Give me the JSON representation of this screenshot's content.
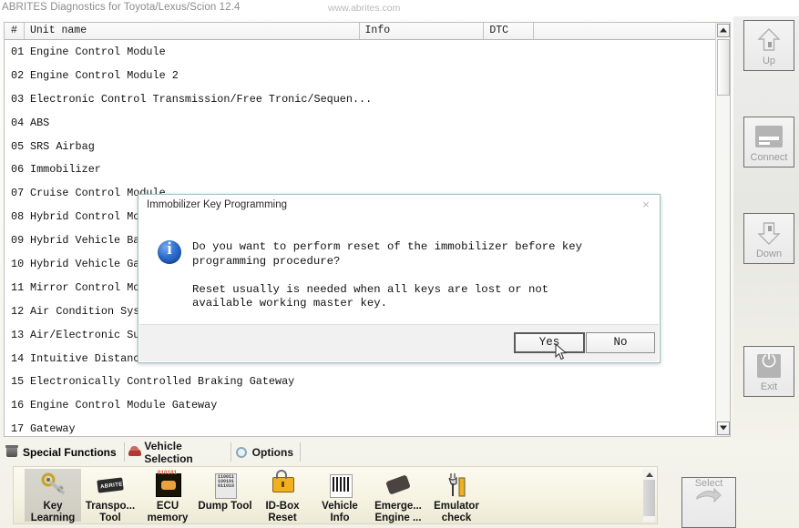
{
  "window": {
    "app_title": "ABRITES Diagnostics for Toyota/Lexus/Scion 12.4",
    "website": "www.abrites.com"
  },
  "table": {
    "columns": [
      "#",
      "Unit name",
      "Info",
      "DTC",
      ""
    ],
    "rows": [
      {
        "idx": "01",
        "name": "Engine Control Module",
        "info": "",
        "dtc": ""
      },
      {
        "idx": "02",
        "name": "Engine Control Module 2",
        "info": "",
        "dtc": ""
      },
      {
        "idx": "03",
        "name": "Electronic Control Transmission/Free Tronic/Sequen...",
        "info": "",
        "dtc": ""
      },
      {
        "idx": "04",
        "name": "ABS",
        "info": "",
        "dtc": ""
      },
      {
        "idx": "05",
        "name": "SRS Airbag",
        "info": "",
        "dtc": ""
      },
      {
        "idx": "06",
        "name": "Immobilizer",
        "info": "",
        "dtc": ""
      },
      {
        "idx": "07",
        "name": "Cruise Control Module",
        "info": "",
        "dtc": ""
      },
      {
        "idx": "08",
        "name": "Hybrid Control Module",
        "info": "",
        "dtc": ""
      },
      {
        "idx": "09",
        "name": "Hybrid Vehicle Battery",
        "info": "",
        "dtc": ""
      },
      {
        "idx": "10",
        "name": "Hybrid Vehicle Gateway",
        "info": "",
        "dtc": ""
      },
      {
        "idx": "11",
        "name": "Mirror Control Module",
        "info": "",
        "dtc": ""
      },
      {
        "idx": "12",
        "name": "Air Condition System",
        "info": "",
        "dtc": ""
      },
      {
        "idx": "13",
        "name": "Air/Electronic Suspension",
        "info": "",
        "dtc": ""
      },
      {
        "idx": "14",
        "name": "Intuitive Distance Assistance/Clearance Sonar",
        "info": "",
        "dtc": ""
      },
      {
        "idx": "15",
        "name": "Electronically Controlled Braking Gateway",
        "info": "",
        "dtc": ""
      },
      {
        "idx": "16",
        "name": "Engine Control Module Gateway",
        "info": "",
        "dtc": ""
      },
      {
        "idx": "17",
        "name": "Gateway",
        "info": "",
        "dtc": ""
      }
    ]
  },
  "sidebar": {
    "buttons": [
      {
        "id": "up",
        "label": "Up",
        "icon": "arrow-up-icon",
        "enabled": false
      },
      {
        "id": "connect",
        "label": "Connect",
        "icon": "connector-icon",
        "enabled": false
      },
      {
        "id": "down",
        "label": "Down",
        "icon": "arrow-down-icon",
        "enabled": false
      },
      {
        "id": "exit",
        "label": "Exit",
        "icon": "power-icon",
        "enabled": false
      }
    ]
  },
  "tabs": [
    {
      "label": "Special Functions",
      "icon": "toolbox-icon",
      "active": true
    },
    {
      "label": "Vehicle Selection",
      "icon": "car-icon",
      "active": false
    },
    {
      "label": "Options",
      "icon": "gear-icon",
      "active": false
    }
  ],
  "functions": [
    {
      "line1": "Key",
      "line2": "Learning",
      "icon": "key-icon",
      "selected": true
    },
    {
      "line1": "Transpo...",
      "line2": "Tool",
      "icon": "transponder-icon",
      "selected": false
    },
    {
      "line1": "ECU",
      "line2": "memory",
      "icon": "ecu-memory-icon",
      "selected": false
    },
    {
      "line1": "Dump Tool",
      "line2": "",
      "icon": "dump-tool-icon",
      "selected": false
    },
    {
      "line1": "ID-Box",
      "line2": "Reset",
      "icon": "padlock-icon",
      "selected": false
    },
    {
      "line1": "Vehicle",
      "line2": "Info",
      "icon": "barcode-icon",
      "selected": false
    },
    {
      "line1": "Emerge...",
      "line2": "Engine ...",
      "icon": "chip-icon",
      "selected": false
    },
    {
      "line1": "Emulator",
      "line2": "check",
      "icon": "wrench-icon",
      "selected": false
    }
  ],
  "select_button": {
    "label": "Select",
    "icon": "arrow-right-icon",
    "enabled": false
  },
  "dialog": {
    "title": "Immobilizer Key Programming",
    "close_label": "×",
    "icon": "info-icon",
    "message": "Do you want to perform reset of the immobilizer before key\nprogramming procedure?\n\nReset usually is needed when all keys are lost or not\navailable working master key.",
    "yes_label": "Yes",
    "no_label": "No"
  },
  "colors": {
    "dialog_border": "#9fc3c0",
    "info_blue": "#2d6fd0",
    "toolbar_cream": "#f6f3e2",
    "tab_text": "#17171a"
  }
}
